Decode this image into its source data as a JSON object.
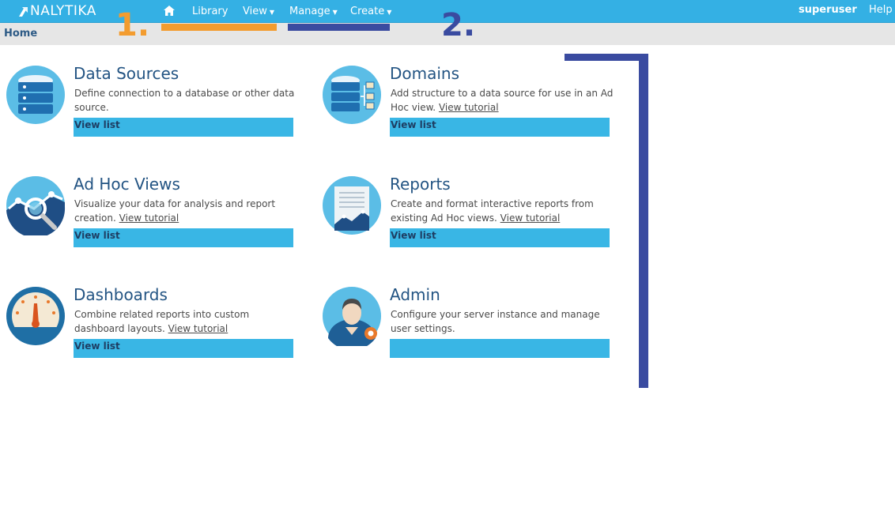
{
  "topbar": {
    "logo_text": "NALYTIKA",
    "nav": {
      "library": "Library",
      "view": "View",
      "manage": "Manage",
      "create": "Create"
    },
    "user": "superuser",
    "help": "Help"
  },
  "breadcrumb": {
    "current": "Home"
  },
  "annotations": {
    "one": "1.",
    "two": "2."
  },
  "colors": {
    "topbar": "#34b0e4",
    "button": "#39b6e5",
    "title": "#235483",
    "annotation_orange": "#f39c2f",
    "annotation_blue": "#3a4ba0"
  },
  "cards": [
    {
      "icon": "database-icon",
      "title": "Data Sources",
      "desc_line": "Define connection to a database or other data source.",
      "tutorial": "",
      "button": "View list"
    },
    {
      "icon": "domain-icon",
      "title": "Domains",
      "desc_line": "Add structure to a data source for use in an Ad Hoc view.",
      "tutorial": "View tutorial",
      "button": "View list"
    },
    {
      "icon": "adhoc-search-icon",
      "title": "Ad Hoc Views",
      "desc_line": "Visualize your data for analysis and report creation.",
      "tutorial": "View tutorial",
      "button": "View list"
    },
    {
      "icon": "report-icon",
      "title": "Reports",
      "desc_line": "Create and format interactive reports from existing Ad Hoc views.",
      "tutorial": "View tutorial",
      "button": "View list"
    },
    {
      "icon": "dashboard-gauge-icon",
      "title": "Dashboards",
      "desc_line": "Combine related reports into custom dashboard layouts.",
      "tutorial": "View tutorial",
      "button": "View list"
    },
    {
      "icon": "admin-user-icon",
      "title": "Admin",
      "desc_line": "Configure your server instance and manage user settings.",
      "tutorial": "",
      "button": ""
    }
  ]
}
